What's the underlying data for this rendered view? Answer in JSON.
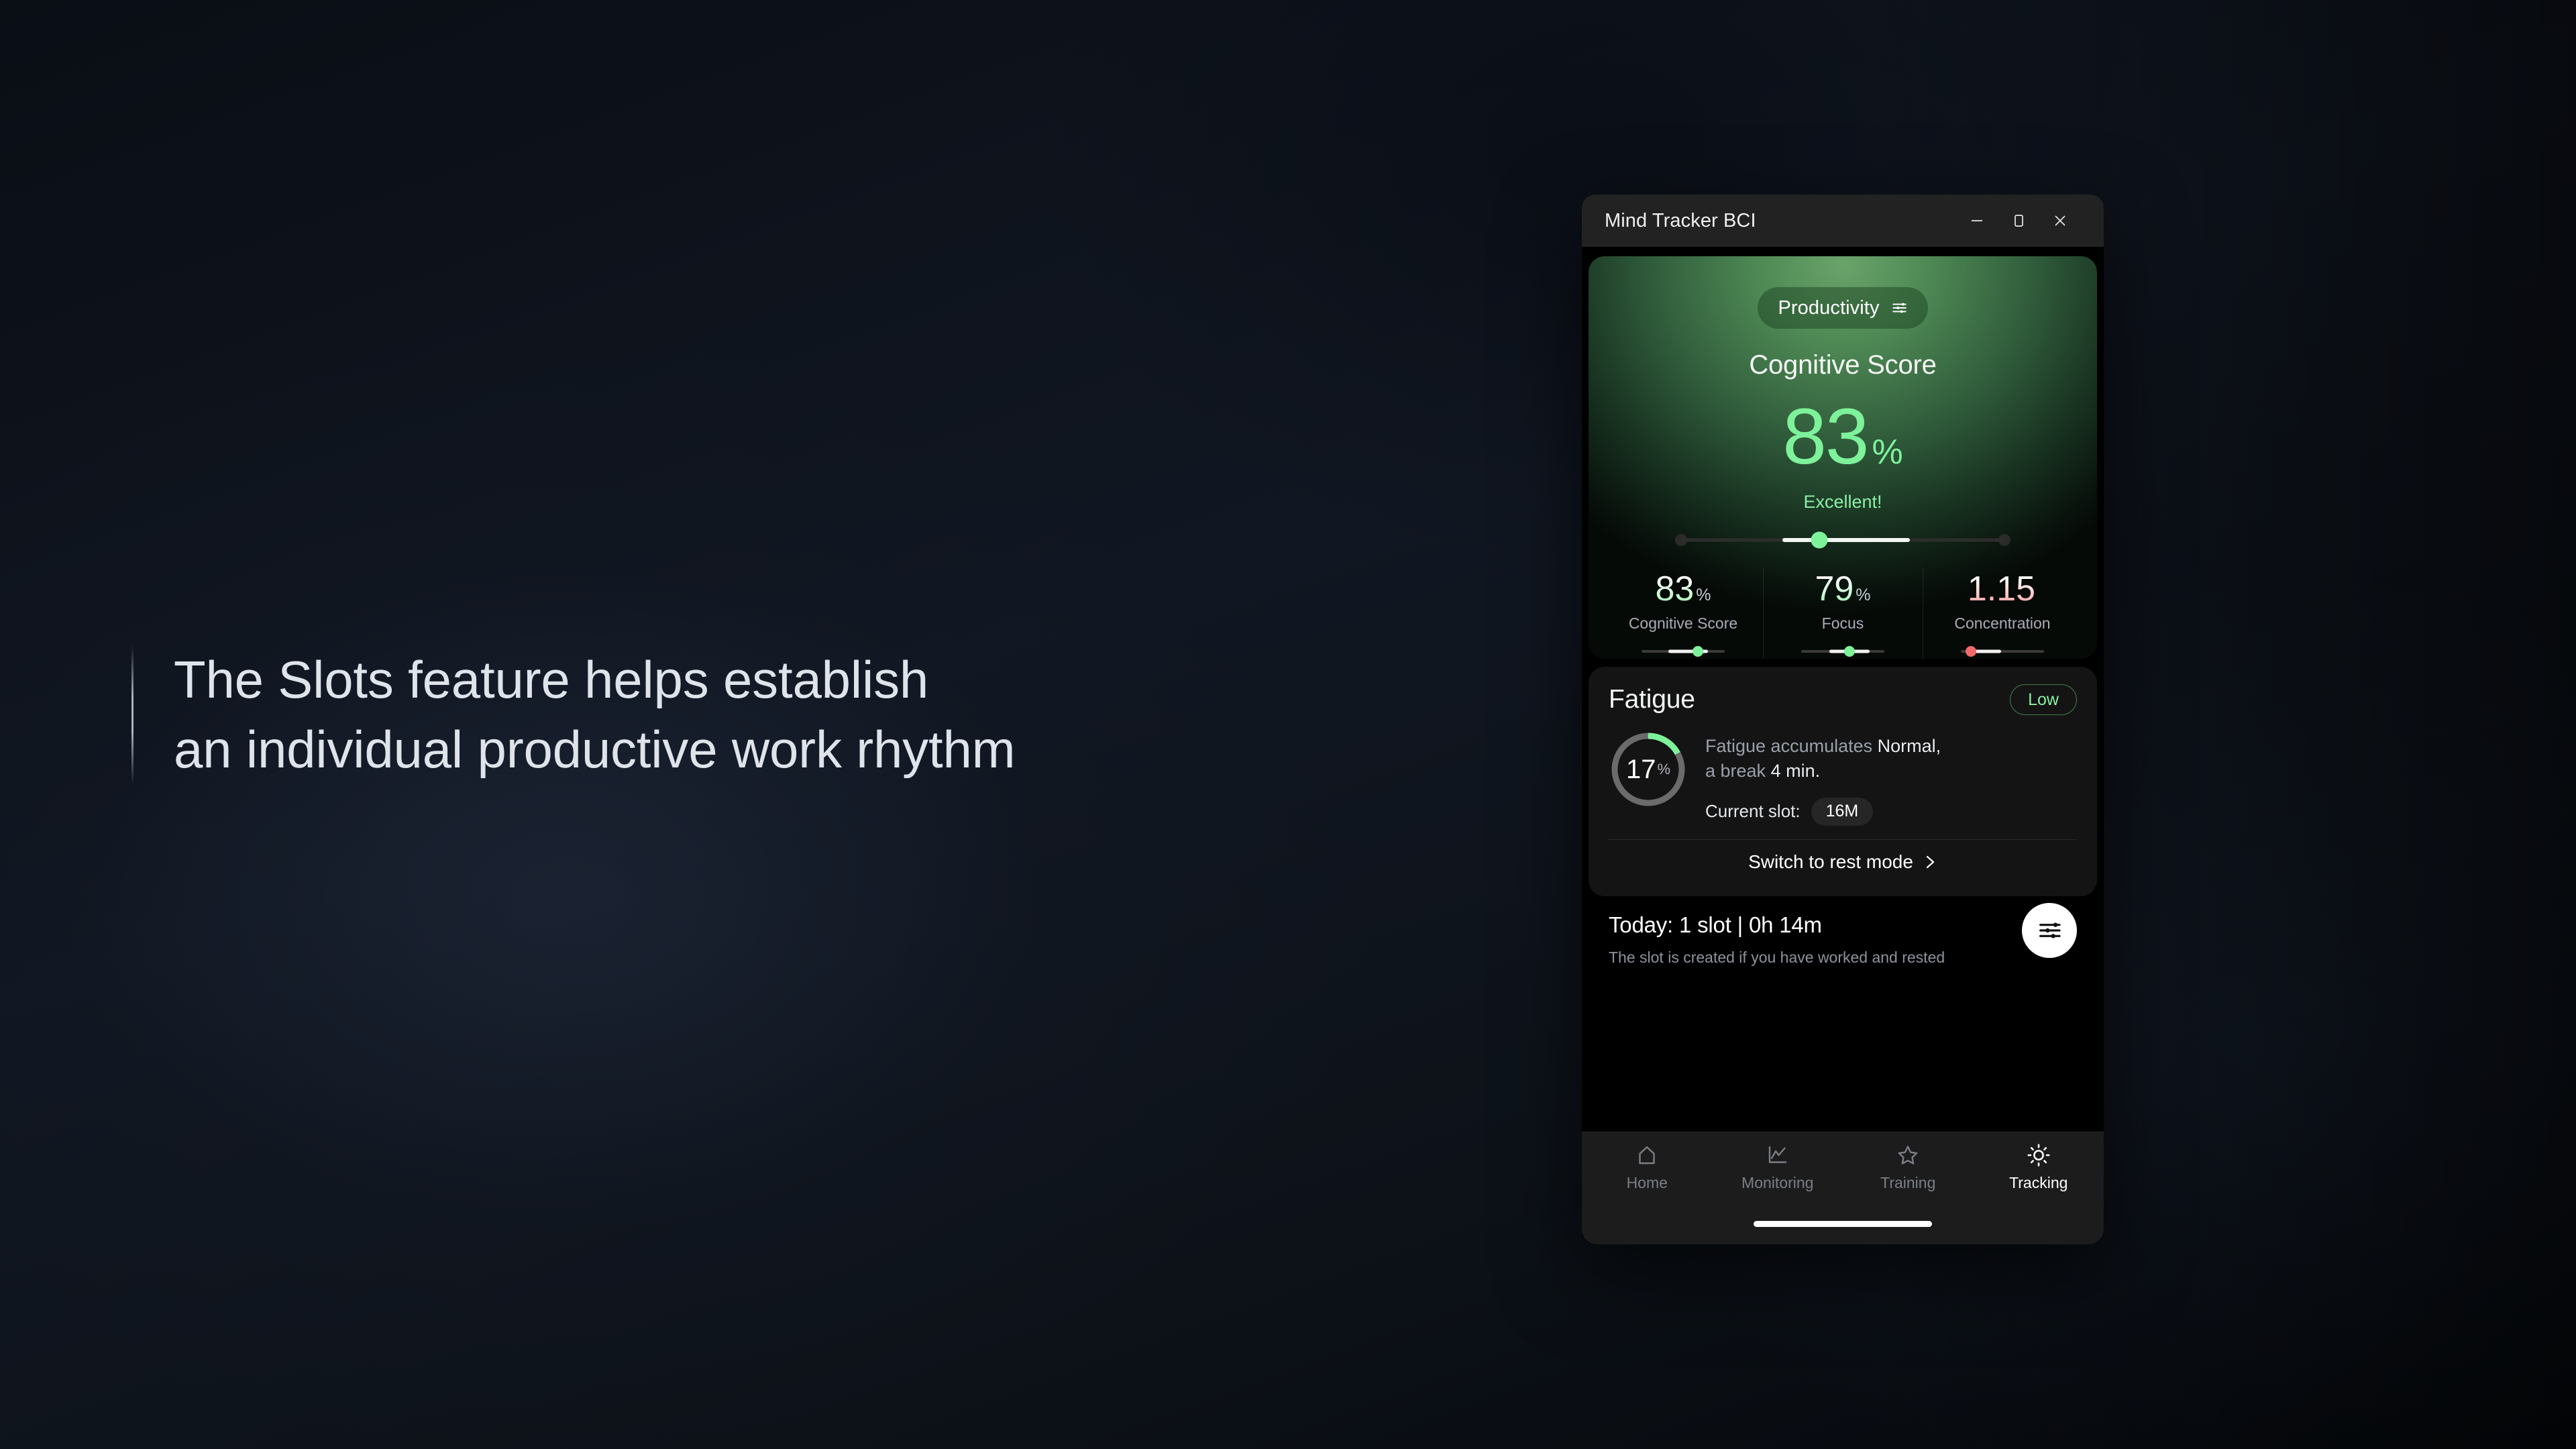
{
  "background": {
    "base_color": "#0b0f16"
  },
  "headline": {
    "text": "The Slots feature helps establish\nan individual productive work rhythm",
    "accent_rule": "vertical-accent-line"
  },
  "window": {
    "title": "Mind Tracker BCI",
    "controls": {
      "minimize": "minimize-icon",
      "maximize": "maximize-icon",
      "close": "close-icon"
    }
  },
  "score_card": {
    "pill_label": "Productivity",
    "pill_icon": "tune-sliders-icon",
    "title": "Cognitive Score",
    "value": "83",
    "unit": "%",
    "verdict": "Excellent!",
    "accent_color": "#7ef29a",
    "slider": {
      "fill_start_pct": 32,
      "fill_width_pct": 38,
      "knob_pct": 43
    }
  },
  "metrics": [
    {
      "value": "83",
      "unit": "%",
      "label": "Cognitive Score",
      "tone": "pos",
      "mini": {
        "fill_start_pct": 32,
        "fill_width_pct": 48,
        "knob_pct": 68,
        "knob_color": "#7ef29a"
      }
    },
    {
      "value": "79",
      "unit": "%",
      "label": "Focus",
      "tone": "pos",
      "mini": {
        "fill_start_pct": 34,
        "fill_width_pct": 48,
        "knob_pct": 58,
        "knob_color": "#7ef29a"
      }
    },
    {
      "value": "1.15",
      "unit": "",
      "label": "Concentration",
      "tone": "neg",
      "mini": {
        "fill_start_pct": 6,
        "fill_width_pct": 42,
        "knob_pct": 12,
        "knob_color": "#f06a6a"
      }
    }
  ],
  "fatigue": {
    "title": "Fatigue",
    "badge": "Low",
    "ring_value": "17",
    "ring_unit": "%",
    "ring_pct": 17,
    "description_muted": "Fatigue accumulates ",
    "description_strong_1": "Normal,",
    "description_muted_2": "a break ",
    "description_strong_2": "4 min.",
    "slot_label": "Current slot:",
    "slot_value": "16M",
    "rest_action": "Switch to rest mode",
    "chevron": "chevron-right-icon"
  },
  "today": {
    "title": "Today: 1 slot | 0h 14m",
    "subtitle": "The slot is created if you have worked and rested",
    "fab_icon": "tune-sliders-icon"
  },
  "nav": {
    "items": [
      {
        "label": "Home",
        "icon": "home-icon",
        "active": false
      },
      {
        "label": "Monitoring",
        "icon": "chart-line-icon",
        "active": false
      },
      {
        "label": "Training",
        "icon": "star-icon",
        "active": false
      },
      {
        "label": "Tracking",
        "icon": "sun-icon",
        "active": true
      }
    ]
  }
}
